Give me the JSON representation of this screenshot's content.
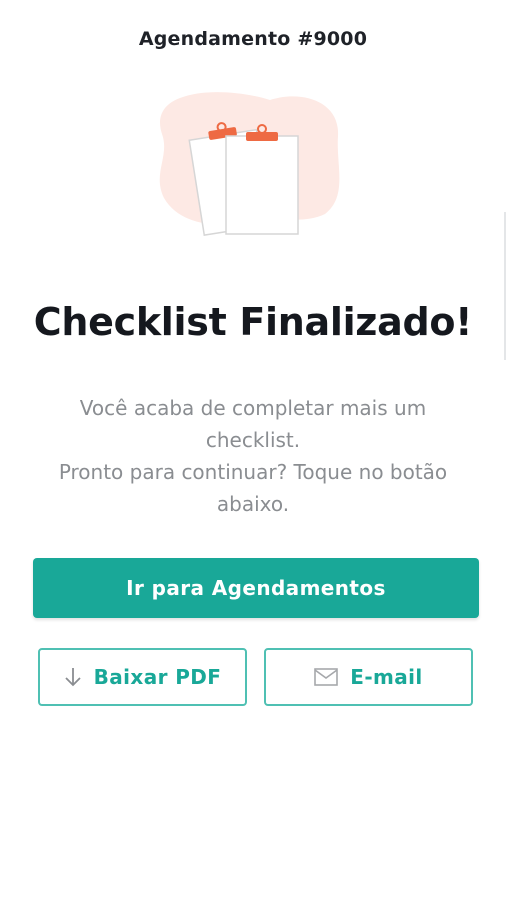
{
  "header": {
    "title": "Agendamento #9000"
  },
  "illustration": {
    "icon": "clipboards-illustration",
    "blob_color": "#fde9e4",
    "clip_color": "#ee6a43"
  },
  "main": {
    "heading": "Checklist Finalizado!",
    "message_lines": [
      "Você acaba de completar mais um",
      "checklist.",
      "Pronto para continuar? Toque no botão",
      "abaixo."
    ]
  },
  "actions": {
    "primary_label": "Ir para Agendamentos",
    "pdf_label": "Baixar PDF",
    "pdf_icon": "arrow-down-icon",
    "email_label": "E-mail",
    "email_icon": "envelope-icon"
  },
  "colors": {
    "accent": "#19a898",
    "accent_border": "#4fc0b3",
    "text_muted": "#8a8d91"
  }
}
